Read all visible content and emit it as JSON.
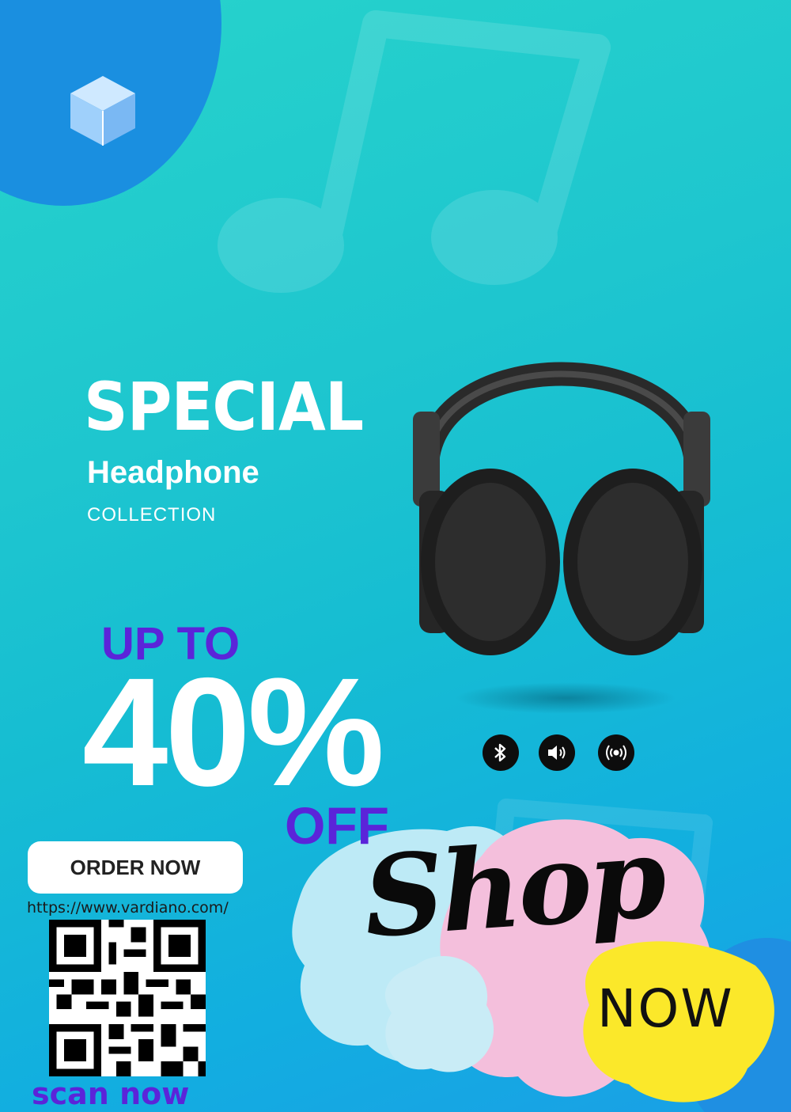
{
  "promo": {
    "title": "SPECIAL",
    "subtitle": "Headphone",
    "tagline": "COLLECTION",
    "discount_prefix": "UP TO",
    "discount_value": "40%",
    "discount_suffix": "OFF"
  },
  "cta": {
    "order_label": "ORDER NOW",
    "url": "https://www.vardiano.com/",
    "scan_label": "scan now",
    "shop_word": "Shop",
    "now_word": "NOW"
  },
  "feature_icons": [
    "bluetooth-icon",
    "speaker-icon",
    "wireless-signal-icon"
  ],
  "colors": {
    "background_top": "#27d3cb",
    "background_bottom": "#1a9fe6",
    "accent_purple": "#5b24d9",
    "circle_blue": "#1a8fe0",
    "splash_blue": "#b9ecf5",
    "splash_pink": "#f5bfdc",
    "splash_yellow": "#fbe82a"
  }
}
